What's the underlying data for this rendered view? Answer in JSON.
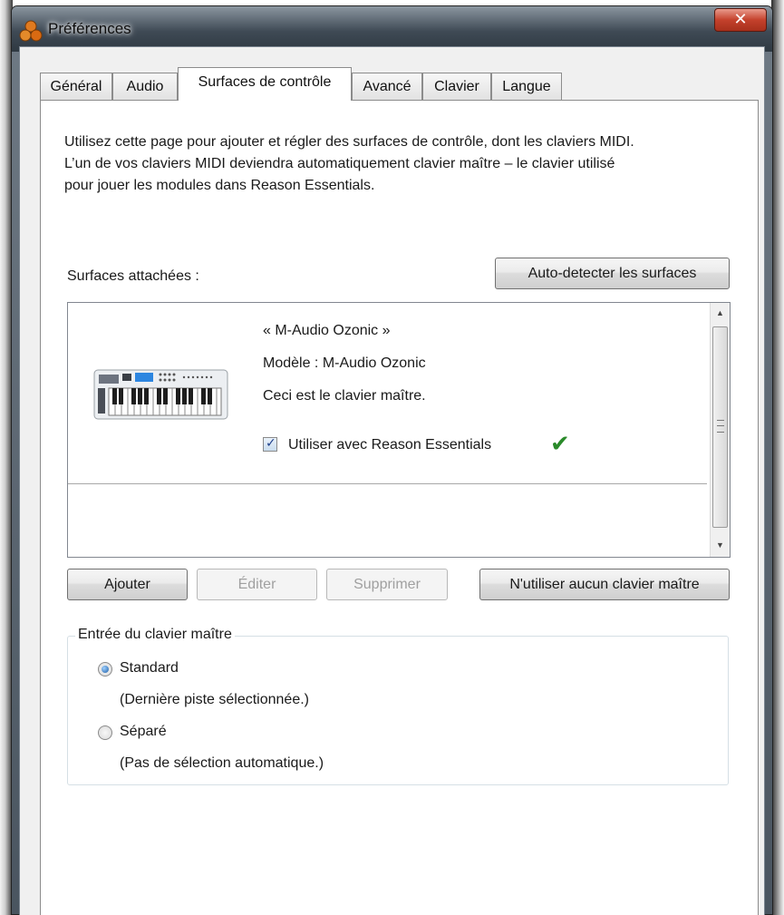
{
  "window": {
    "title": "Préférences",
    "close_symbol": "✕"
  },
  "tabs": [
    {
      "label": "Général",
      "active": false
    },
    {
      "label": "Audio",
      "active": false
    },
    {
      "label": "Surfaces de contrôle",
      "active": true
    },
    {
      "label": "Avancé",
      "active": false
    },
    {
      "label": "Clavier",
      "active": false
    },
    {
      "label": "Langue",
      "active": false
    }
  ],
  "page": {
    "description_lines": [
      "Utilisez cette page pour ajouter et régler des surfaces de contrôle, dont les claviers MIDI.",
      "L’un de vos claviers MIDI deviendra automatiquement clavier maître – le clavier utilisé",
      "pour jouer les modules dans Reason Essentials."
    ],
    "attached_label": "Surfaces attachées :",
    "autodetect_button": "Auto-detecter les surfaces"
  },
  "surface": {
    "name": "« M-Audio Ozonic »",
    "model": "Modèle : M-Audio Ozonic",
    "status": "Ceci est le clavier maître.",
    "use_with_label": "Utiliser avec Reason Essentials",
    "use_with_checked": true,
    "checkmark": "✔",
    "check_symbol": "✓"
  },
  "buttons": {
    "add": "Ajouter",
    "edit": "Éditer",
    "remove": "Supprimer",
    "no_master": "N'utiliser aucun clavier maître"
  },
  "master_input": {
    "legend": "Entrée du clavier maître",
    "options": [
      {
        "label": "Standard",
        "detail": "(Dernière piste sélectionnée.)",
        "selected": true
      },
      {
        "label": "Séparé",
        "detail": "(Pas de sélection automatique.)",
        "selected": false
      }
    ]
  },
  "scrollbar": {
    "up_arrow": "▲",
    "down_arrow": "▼"
  },
  "colors": {
    "checkmark_green": "#2a8a2a",
    "close_red": "#c4412c",
    "window_frame": "#4a5560"
  }
}
